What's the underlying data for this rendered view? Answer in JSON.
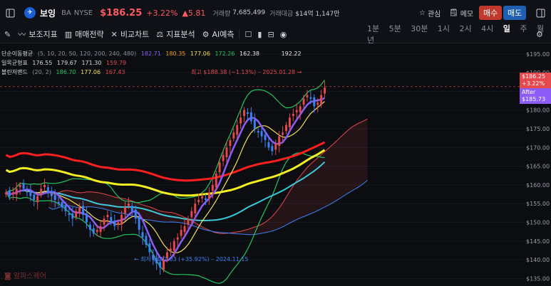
{
  "header": {
    "name": "보잉",
    "ticker": "BA",
    "exchange": "NYSE",
    "price": "$186.25",
    "change_pct": "+3.22%",
    "change_abs": "▲5.81",
    "volume_label": "거래량",
    "volume": "7,685,499",
    "amount_label": "거래대금",
    "amount": "$14억 1,147만",
    "watch_label": "관심",
    "memo_label": "메모",
    "buy_label": "매수",
    "sell_label": "매도"
  },
  "toolbar": {
    "items": [
      "보조지표",
      "매매전략",
      "비교차트",
      "지표분석",
      "AI예측"
    ],
    "periods": [
      "1분",
      "5분",
      "30분",
      "1시",
      "2시",
      "4시",
      "일",
      "주",
      "월",
      "년"
    ],
    "active_period": "일"
  },
  "legend": {
    "sma_label": "단순이동평균",
    "sma_params": "(5, 10, 20, 50, 120, 200, 240, 480)",
    "sma_values": [
      "182.71",
      "180.35",
      "177.06",
      "172.26",
      "162.38",
      "",
      "",
      "192.22"
    ],
    "ichimoku_label": "일목균형표",
    "ichimoku_values": [
      "176.55",
      "179.67",
      "171.30",
      "159.79"
    ],
    "bb_label": "볼린저밴드",
    "bb_params": "(20, 2)",
    "bb_values": [
      "186.70",
      "177.06",
      "167.43"
    ]
  },
  "annotations": {
    "high": "최고 $188.38 (−1.13%) – 2025.01.28 →",
    "low": "← 최저 $137.03 (+35.92%) – 2024.11.15"
  },
  "price_tags": {
    "current": "$186.25",
    "current_pct": "+3.22%",
    "after_label": "After",
    "after_price": "$185.73"
  },
  "watermark": "알파스퀘어",
  "colors": {
    "up": "#e5484d",
    "down": "#3b82f6",
    "sma5": "#8b5cf6",
    "sma20": "#ff1f1f",
    "sma200": "#f2ee1f",
    "sma240": "#3bc9db"
  },
  "chart_data": {
    "type": "candlestick",
    "ylim": [
      133,
      198
    ],
    "yticks": [
      195,
      190,
      185,
      180,
      175,
      170,
      165,
      160,
      155,
      150,
      145,
      140,
      135
    ],
    "closes": [
      158,
      157,
      158,
      159,
      160,
      159,
      158,
      157,
      156,
      157,
      159,
      160,
      158,
      157,
      156,
      155,
      154,
      153,
      152,
      151,
      153,
      154,
      152,
      150,
      148,
      147,
      148,
      149,
      151,
      152,
      150,
      149,
      150,
      152,
      154,
      155,
      153,
      151,
      148,
      146,
      144,
      142,
      140,
      139,
      138,
      140,
      142,
      143,
      145,
      146,
      148,
      149,
      151,
      153,
      155,
      156,
      157,
      156,
      158,
      160,
      163,
      166,
      168,
      170,
      172,
      174,
      176,
      178,
      180,
      179,
      177,
      175,
      174,
      173,
      172,
      170,
      169,
      171,
      173,
      174,
      176,
      178,
      179,
      180,
      181,
      183,
      184,
      183,
      181,
      182,
      184,
      186
    ]
  }
}
